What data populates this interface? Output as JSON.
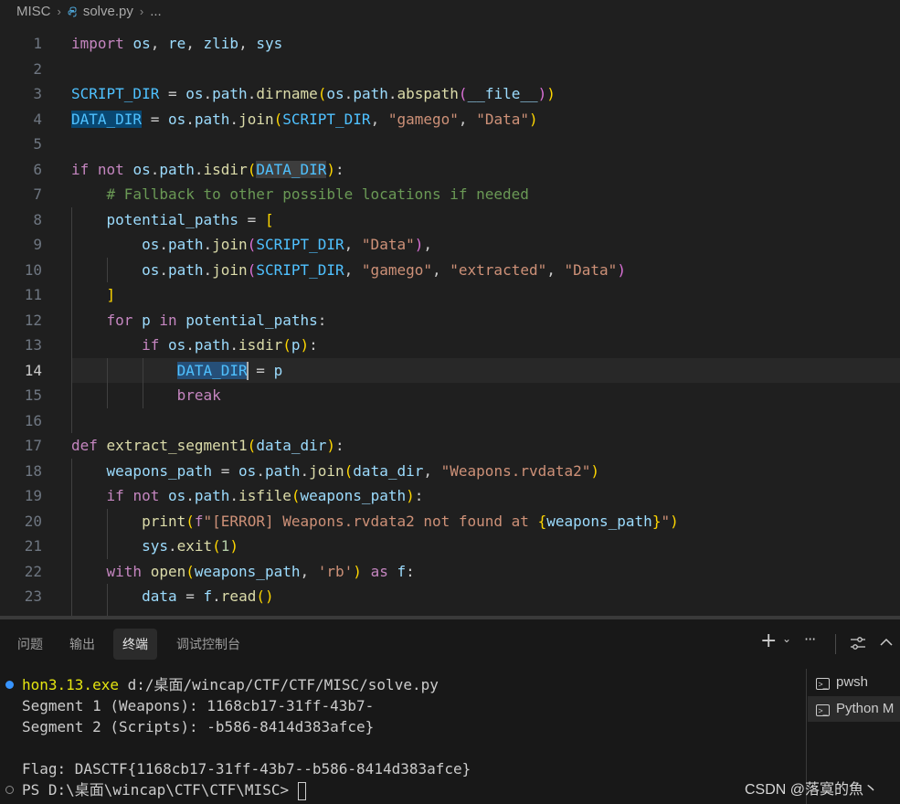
{
  "breadcrumb": {
    "folder": "MISC",
    "file": "solve.py",
    "more": "..."
  },
  "editor": {
    "current_line": 14,
    "lines": [
      {
        "n": "1",
        "t": "import os, re, zlib, sys"
      },
      {
        "n": "2",
        "t": ""
      },
      {
        "n": "3",
        "t": "SCRIPT_DIR = os.path.dirname(os.path.abspath(__file__))"
      },
      {
        "n": "4",
        "t": "DATA_DIR = os.path.join(SCRIPT_DIR, \"gamego\", \"Data\")"
      },
      {
        "n": "5",
        "t": ""
      },
      {
        "n": "6",
        "t": "if not os.path.isdir(DATA_DIR):"
      },
      {
        "n": "7",
        "t": "    # Fallback to other possible locations if needed"
      },
      {
        "n": "8",
        "t": "    potential_paths = ["
      },
      {
        "n": "9",
        "t": "        os.path.join(SCRIPT_DIR, \"Data\"),"
      },
      {
        "n": "10",
        "t": "        os.path.join(SCRIPT_DIR, \"gamego\", \"extracted\", \"Data\")"
      },
      {
        "n": "11",
        "t": "    ]"
      },
      {
        "n": "12",
        "t": "    for p in potential_paths:"
      },
      {
        "n": "13",
        "t": "        if os.path.isdir(p):"
      },
      {
        "n": "14",
        "t": "            DATA_DIR = p"
      },
      {
        "n": "15",
        "t": "            break"
      },
      {
        "n": "16",
        "t": ""
      },
      {
        "n": "17",
        "t": "def extract_segment1(data_dir):"
      },
      {
        "n": "18",
        "t": "    weapons_path = os.path.join(data_dir, \"Weapons.rvdata2\")"
      },
      {
        "n": "19",
        "t": "    if not os.path.isfile(weapons_path):"
      },
      {
        "n": "20",
        "t": "        print(f\"[ERROR] Weapons.rvdata2 not found at {weapons_path}\")"
      },
      {
        "n": "21",
        "t": "        sys.exit(1)"
      },
      {
        "n": "22",
        "t": "    with open(weapons_path, 'rb') as f:"
      },
      {
        "n": "23",
        "t": "        data = f.read()"
      }
    ]
  },
  "panel": {
    "tabs": [
      "问题",
      "输出",
      "终端",
      "调试控制台"
    ],
    "active_tab": "终端",
    "toolbar": {
      "add": "+",
      "add_dropdown": "⌄",
      "more": "···",
      "maximize": "⌃"
    }
  },
  "terminal": {
    "lines": [
      "hon3.13.exe d:/桌面/wincap/CTF/CTF/MISC/solve.py",
      "Segment 1 (Weapons): 1168cb17-31ff-43b7-",
      "Segment 2 (Scripts): -b586-8414d383afce}",
      "",
      "Flag: DASCTF{1168cb17-31ff-43b7--b586-8414d383afce}",
      "PS D:\\桌面\\wincap\\CTF\\CTF\\MISC> "
    ],
    "exe_part": "hon3.13.exe",
    "cmd_rest": " d:/桌面/wincap/CTF/CTF/MISC/solve.py",
    "prompt": "PS D:\\桌面\\wincap\\CTF\\CTF\\MISC> ",
    "list": [
      "pwsh",
      "Python M"
    ]
  },
  "colors": {
    "background": "#1f1f1f",
    "panel": "#181818",
    "keyword": "#c586c0",
    "function": "#dcdcaa",
    "string": "#ce9178",
    "variable": "#9cdcfe",
    "comment": "#6a9955",
    "success_dot": "#3794ff"
  },
  "watermark": "CSDN @落寞的魚丶"
}
